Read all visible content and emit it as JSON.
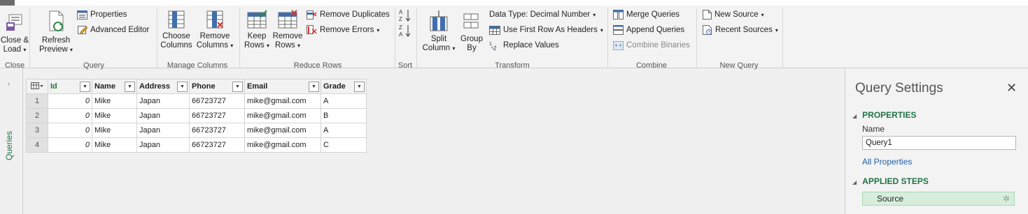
{
  "ribbon": {
    "groups": {
      "close": {
        "label": "Close",
        "close_load": {
          "line1": "Close &",
          "line2": "Load"
        }
      },
      "query": {
        "label": "Query",
        "refresh_preview": {
          "line1": "Refresh",
          "line2": "Preview"
        },
        "properties": "Properties",
        "advanced_editor": "Advanced Editor"
      },
      "manage_columns": {
        "label": "Manage Columns",
        "choose_columns": {
          "line1": "Choose",
          "line2": "Columns"
        },
        "remove_columns": {
          "line1": "Remove",
          "line2": "Columns"
        }
      },
      "reduce_rows": {
        "label": "Reduce Rows",
        "keep_rows": {
          "line1": "Keep",
          "line2": "Rows"
        },
        "remove_rows": {
          "line1": "Remove",
          "line2": "Rows"
        },
        "remove_duplicates": "Remove Duplicates",
        "remove_errors": "Remove Errors"
      },
      "sort": {
        "label": "Sort"
      },
      "transform": {
        "label": "Transform",
        "split_column": {
          "line1": "Split",
          "line2": "Column"
        },
        "group_by": {
          "line1": "Group",
          "line2": "By"
        },
        "data_type": "Data Type: Decimal Number",
        "use_first_row": "Use First Row As Headers",
        "replace_values": "Replace Values"
      },
      "combine": {
        "label": "Combine",
        "merge_queries": "Merge Queries",
        "append_queries": "Append Queries",
        "combine_binaries": "Combine Binaries"
      },
      "new_query": {
        "label": "New Query",
        "new_source": "New Source",
        "recent_sources": "Recent Sources"
      }
    }
  },
  "left_pane": {
    "label": "Queries"
  },
  "grid": {
    "columns": [
      "Id",
      "Name",
      "Address",
      "Phone",
      "Email",
      "Grade"
    ],
    "rows": [
      {
        "n": "1",
        "cells": [
          "0",
          "Mike",
          "Japan",
          "66723727",
          "mike@gmail.com",
          "A"
        ]
      },
      {
        "n": "2",
        "cells": [
          "0",
          "Mike",
          "Japan",
          "66723727",
          "mike@gmail.com",
          "B"
        ]
      },
      {
        "n": "3",
        "cells": [
          "0",
          "Mike",
          "Japan",
          "66723727",
          "mike@gmail.com",
          "A"
        ]
      },
      {
        "n": "4",
        "cells": [
          "0",
          "Mike",
          "Japan",
          "66723727",
          "mike@gmail.com",
          "C"
        ]
      }
    ]
  },
  "query_settings": {
    "title": "Query Settings",
    "properties_header": "PROPERTIES",
    "name_label": "Name",
    "name_value": "Query1",
    "all_properties": "All Properties",
    "applied_steps_header": "APPLIED STEPS",
    "steps": [
      "Source"
    ]
  },
  "colors": {
    "accent_green": "#217346",
    "link_blue": "#1e5fa8"
  }
}
